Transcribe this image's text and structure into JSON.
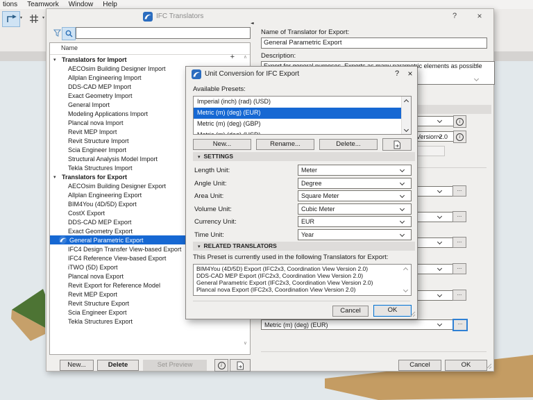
{
  "colors": {
    "selection_blue": "#1668d3",
    "ok_focus_border": "#0b72c9",
    "canvas_bg": "#e2e8eb",
    "terrain_green": "#4d7434",
    "terrain_tan": "#c49d66"
  },
  "menu_bar": {
    "items": [
      "tions",
      "Teamwork",
      "Window",
      "Help"
    ]
  },
  "toolbar": {
    "icons": [
      "arrow-tool-icon",
      "grid-snap-icon"
    ]
  },
  "translators_window": {
    "title": "IFC Translators",
    "help_glyph": "?",
    "close_glyph": "×",
    "search": {
      "value": "",
      "placeholder": ""
    },
    "list": {
      "header": "Name",
      "groups": [
        {
          "label": "Translators for Import",
          "add_button": "+",
          "items": [
            "AECOsim Building Designer Import",
            "Allplan Engineering Import",
            "DDS-CAD MEP Import",
            "Exact Geometry Import",
            "General Import",
            "Modeling Applications Import",
            "Plancal nova Import",
            "Revit MEP Import",
            "Revit Structure Import",
            "Scia Engineer Import",
            "Structural Analysis Model Import",
            "Tekla Structures Import"
          ],
          "selected_index": -1
        },
        {
          "label": "Translators for Export",
          "items": [
            "AECOsim Building Designer Export",
            "Allplan Engineering Export",
            "BIM4You (4D/5D) Export",
            "CostX Export",
            "DDS-CAD MEP Export",
            "Exact Geometry Export",
            "General Parametric Export",
            "IFC4 Design Transfer View-based Export",
            "IFC4 Reference View-based Export",
            "iTWO (5D) Export",
            "Plancal nova Export",
            "Revit Export for Reference Model",
            "Revit MEP Export",
            "Revit Structure Export",
            "Scia Engineer Export",
            "Tekla Structures Export"
          ],
          "selected_index": 6
        }
      ]
    },
    "footer_buttons": {
      "new": "New...",
      "delete": "Delete",
      "set_preview": "Set Preview"
    },
    "right_panel": {
      "name_label": "Name of Translator for Export:",
      "name_value": "General Parametric Export",
      "description_label": "Description:",
      "description_value": "Export for general purposes. Exports as many parametric elements as possible with all",
      "version_value": "IFC2x3, Coordination View Version 2.0",
      "unit_preset_value": "Metric (m) (deg) (EUR)",
      "cancel": "Cancel",
      "ok": "OK"
    }
  },
  "unit_dialog": {
    "title": "Unit Conversion for IFC Export",
    "help_glyph": "?",
    "close_glyph": "×",
    "available_presets_label": "Available Presets:",
    "presets": [
      "Imperial (inch) (rad) (USD)",
      "Metric (m) (deg) (EUR)",
      "Metric (m) (deg) (GBP)",
      "Metric (m) (deg) (USD)"
    ],
    "selected_preset_index": 1,
    "preset_buttons": {
      "new": "New...",
      "rename": "Rename...",
      "delete": "Delete..."
    },
    "settings": {
      "header": "SETTINGS",
      "rows": [
        {
          "label": "Length Unit:",
          "value": "Meter"
        },
        {
          "label": "Angle Unit:",
          "value": "Degree"
        },
        {
          "label": "Area Unit:",
          "value": "Square Meter"
        },
        {
          "label": "Volume Unit:",
          "value": "Cubic Meter"
        },
        {
          "label": "Currency Unit:",
          "value": "EUR"
        },
        {
          "label": "Time Unit:",
          "value": "Year"
        }
      ]
    },
    "related": {
      "header": "RELATED TRANSLATORS",
      "caption": "This Preset is currently used in the following Translators for Export:",
      "items": [
        "BIM4You (4D/5D) Export (IFC2x3, Coordination View Version 2.0)",
        "DDS-CAD MEP Export (IFC2x3, Coordination View Version 2.0)",
        "General Parametric Export (IFC2x3, Coordination View Version 2.0)",
        "Plancal nova Export (IFC2x3, Coordination View Version 2.0)"
      ]
    },
    "cancel": "Cancel",
    "ok": "OK"
  }
}
